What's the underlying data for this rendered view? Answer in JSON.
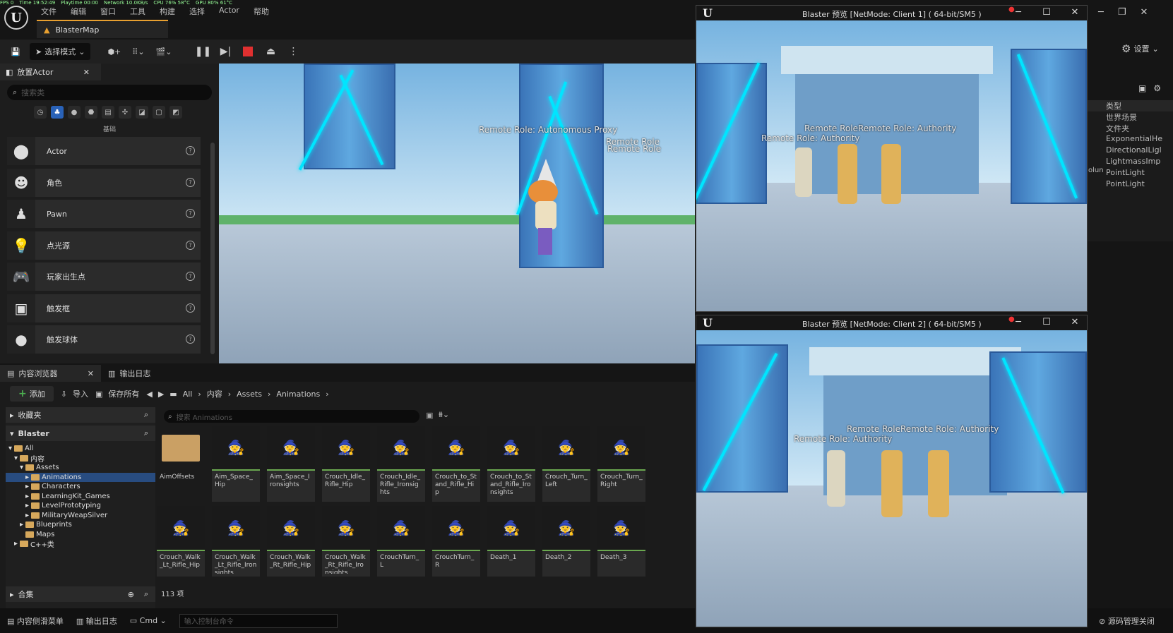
{
  "stats": {
    "fps": "FPS 0",
    "time": "Time 19:52:49",
    "playtime": "Playtime 00:00",
    "network": "Network 10.0KB/s",
    "cpu": "CPU 76% 58°C",
    "gpu": "GPU 80% 61°C"
  },
  "menu": [
    "文件",
    "编辑",
    "窗口",
    "工具",
    "构建",
    "选择",
    "Actor",
    "帮助"
  ],
  "map_tab": "BlasterMap",
  "toolbar": {
    "mode": "选择模式",
    "settings": "设置"
  },
  "place_actors": {
    "tab": "放置Actor",
    "search_placeholder": "搜索类",
    "category": "基础",
    "items": [
      {
        "name": "Actor",
        "icon": "⬤"
      },
      {
        "name": "角色",
        "icon": "☻"
      },
      {
        "name": "Pawn",
        "icon": "♟"
      },
      {
        "name": "点光源",
        "icon": "💡"
      },
      {
        "name": "玩家出生点",
        "icon": "🎮"
      },
      {
        "name": "触发框",
        "icon": "▣"
      },
      {
        "name": "触发球体",
        "icon": "●"
      }
    ]
  },
  "viewport": {
    "label1": "Remote Role: Autonomous Proxy",
    "label2": "Remote Role",
    "label3": "Remote Role"
  },
  "content_browser": {
    "tab": "内容浏览器",
    "log_tab": "输出日志",
    "add": "添加",
    "import": "导入",
    "save_all": "保存所有",
    "breadcrumbs": [
      "All",
      "内容",
      "Assets",
      "Animations"
    ],
    "favorites": "收藏夹",
    "project": "Blaster",
    "collections": "合集",
    "tree": [
      {
        "label": "All",
        "indent": 0
      },
      {
        "label": "内容",
        "indent": 1
      },
      {
        "label": "Assets",
        "indent": 2
      },
      {
        "label": "Animations",
        "indent": 3,
        "selected": true
      },
      {
        "label": "Characters",
        "indent": 3
      },
      {
        "label": "LearningKit_Games",
        "indent": 3
      },
      {
        "label": "LevelPrototyping",
        "indent": 3
      },
      {
        "label": "MilitaryWeapSilver",
        "indent": 3
      },
      {
        "label": "Blueprints",
        "indent": 2
      },
      {
        "label": "Maps",
        "indent": 2
      },
      {
        "label": "C++类",
        "indent": 1
      }
    ],
    "search_placeholder": "搜索 Animations",
    "assets_row1": [
      "AimOffsets",
      "Aim_Space_Hip",
      "Aim_Space_Ironsights",
      "Crouch_Idle_Rifle_Hip",
      "Crouch_Idle_Rifle_Ironsights",
      "Crouch_to_Stand_Rifle_Hip",
      "Crouch_to_Stand_Rifle_Ironsights",
      "Crouch_Turn_Left",
      "Crouch_Turn_Right"
    ],
    "assets_row2": [
      "Crouch_Walk_Lt_Rifle_Hip",
      "Crouch_Walk_Lt_Rifle_Ironsights",
      "Crouch_Walk_Rt_Rifle_Hip",
      "Crouch_Walk_Rt_Rifle_Ironsights",
      "CrouchTurn_L",
      "CrouchTurn_R",
      "Death_1",
      "Death_2",
      "Death_3"
    ],
    "count": "113 项"
  },
  "statusbar": {
    "drawer": "内容侧滑菜单",
    "log": "输出日志",
    "cmd": "Cmd",
    "cmd_placeholder": "输入控制台命令",
    "source_control": "源码管理关闭"
  },
  "outliner": {
    "header": "类型",
    "items": [
      "世界场景",
      "文件夹",
      "ExponentialHe",
      "DirectionalLigl",
      "LightmassImp",
      "PointLight",
      "PointLight"
    ],
    "side_label": "olun"
  },
  "pie1": {
    "title": "Blaster 预览 [NetMode: Client 1]  ( 64-bit/SM5 )",
    "label_a": "Remote RoleRemote Role: Authority",
    "label_b": "Remote Role: Authority"
  },
  "pie2": {
    "title": "Blaster 预览 [NetMode: Client 2]  ( 64-bit/SM5 )",
    "label_a": "Remote RoleRemote Role: Authority",
    "label_b": "Remote Role: Authority"
  }
}
